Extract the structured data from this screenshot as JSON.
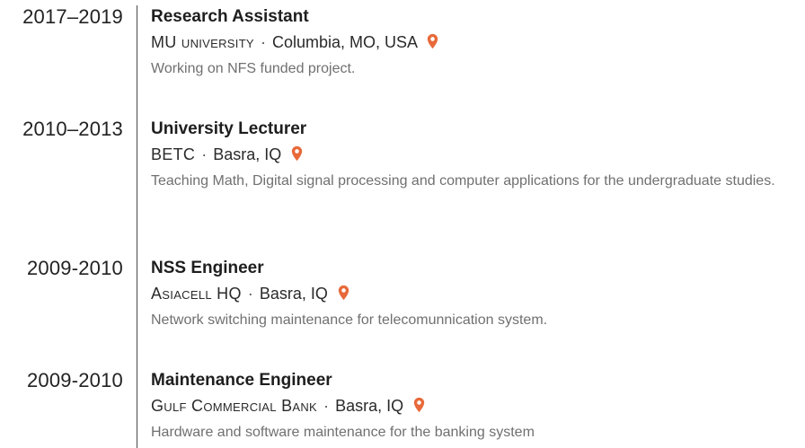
{
  "entries": [
    {
      "date": "2017–2019",
      "title": "Research Assistant",
      "org": "MU university",
      "separator": "·",
      "location": "Columbia, MO, USA",
      "description": "Working on NFS funded project."
    },
    {
      "date": "2010–2013",
      "title": "University Lecturer",
      "org": "BETC",
      "separator": "·",
      "location": "Basra, IQ",
      "description": "Teaching Math, Digital signal processing and computer applications for the undergraduate studies."
    },
    {
      "date": "2009-2010",
      "title": "NSS Engineer",
      "org": "Asiacell HQ",
      "separator": "·",
      "location": "Basra, IQ",
      "description": "Network switching maintenance for telecomunnication system."
    },
    {
      "date": "2009-2010",
      "title": "Maintenance Engineer",
      "org": "Gulf Commercial Bank",
      "separator": "·",
      "location": "Basra, IQ",
      "description": "Hardware and software maintenance for the banking system"
    }
  ],
  "colors": {
    "pin": "#e8693a",
    "timeline": "#4a4a4a",
    "description": "#707070"
  },
  "icons": {
    "location": "map-marker-icon"
  }
}
